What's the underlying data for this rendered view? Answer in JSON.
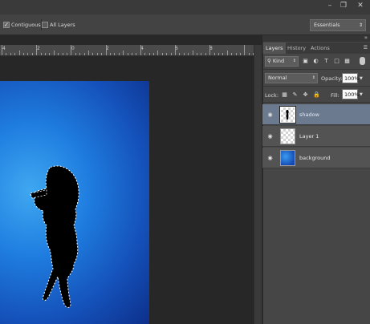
{
  "options": {
    "contiguous_label": "Contiguous",
    "all_layers_label": "All Layers",
    "workspace": "Essentials"
  },
  "ruler": {
    "labels": [
      "4",
      "2",
      "0",
      "2",
      "4",
      "6",
      "8"
    ]
  },
  "panel": {
    "tabs": [
      "Layers",
      "History",
      "Actions"
    ],
    "filter_kind": "Kind",
    "blend_mode": "Normal",
    "opacity_label": "Opacity:",
    "opacity_value": "100%",
    "lock_label": "Lock:",
    "fill_label": "Fill:",
    "fill_value": "100%",
    "layers": [
      {
        "name": "shadow",
        "selected": true
      },
      {
        "name": "Layer 1",
        "selected": false
      },
      {
        "name": "background",
        "selected": false
      }
    ]
  },
  "colors": {
    "canvas_blue": "#1f7de0",
    "selected_layer": "#6b7a8f"
  }
}
